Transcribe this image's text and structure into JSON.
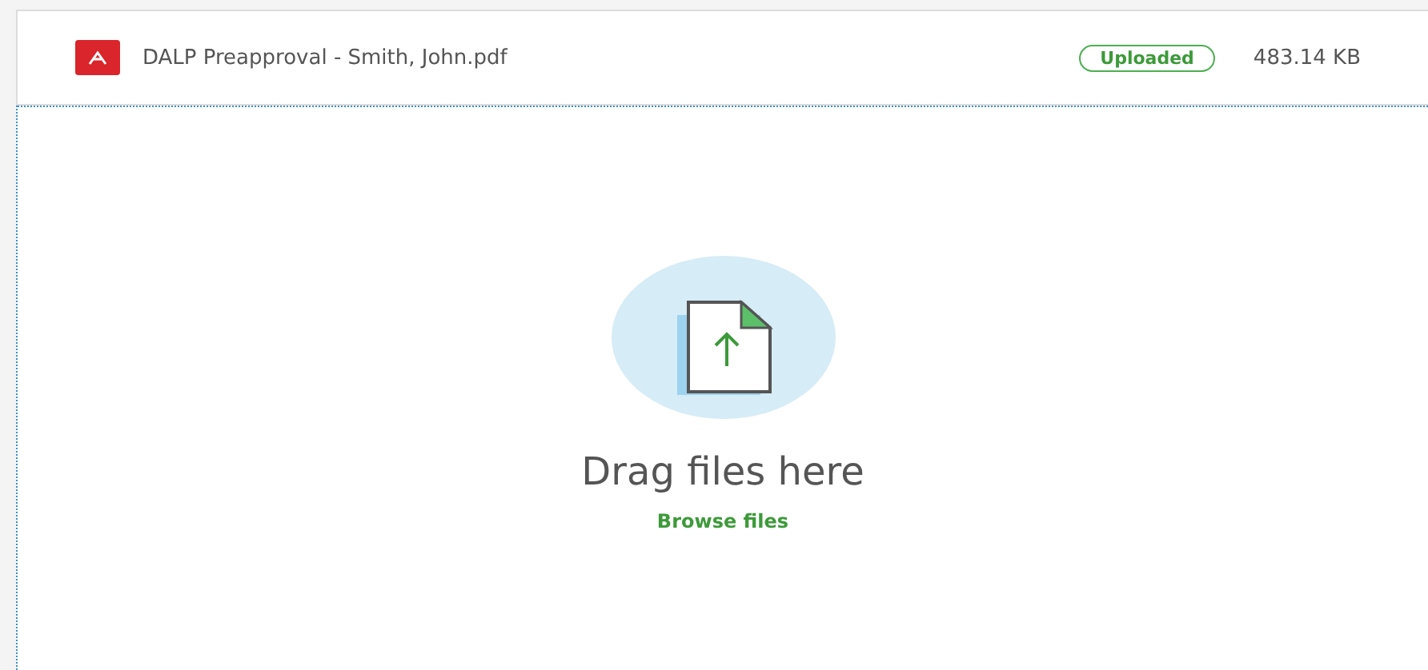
{
  "files": [
    {
      "name": "DALP Preapproval - Smith, John.pdf",
      "status": "Uploaded",
      "size": "483.14 KB"
    }
  ],
  "dropzone": {
    "title": "Drag files here",
    "link": "Browse files"
  }
}
